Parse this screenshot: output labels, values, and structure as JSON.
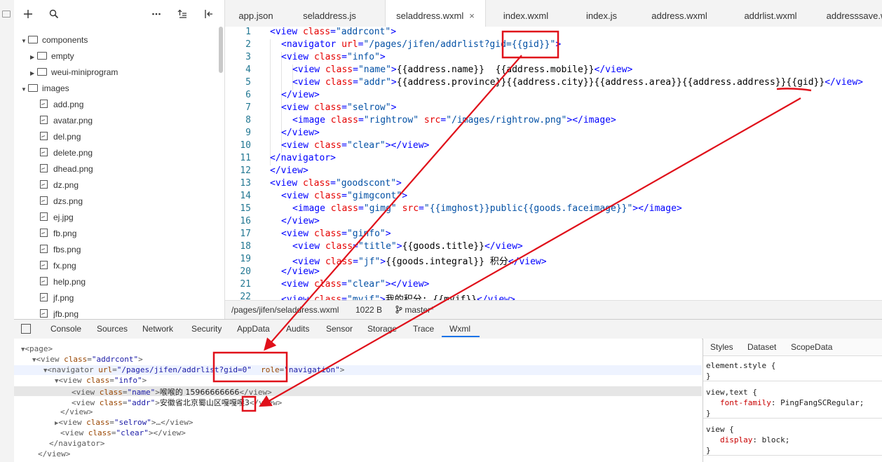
{
  "toolbar": {
    "icons": [
      "plus-icon",
      "search-icon",
      "more-icon",
      "sort-icon",
      "split-icon"
    ]
  },
  "tree": {
    "items": [
      {
        "label": "components",
        "kind": "folder",
        "open": true,
        "depth": 0
      },
      {
        "label": "empty",
        "kind": "folder",
        "open": false,
        "depth": 1
      },
      {
        "label": "weui-miniprogram",
        "kind": "folder",
        "open": false,
        "depth": 1
      },
      {
        "label": "images",
        "kind": "folder",
        "open": true,
        "depth": 0
      },
      {
        "label": "add.png",
        "kind": "image",
        "depth": 1
      },
      {
        "label": "avatar.png",
        "kind": "image",
        "depth": 1
      },
      {
        "label": "del.png",
        "kind": "image",
        "depth": 1
      },
      {
        "label": "delete.png",
        "kind": "image",
        "depth": 1
      },
      {
        "label": "dhead.png",
        "kind": "image",
        "depth": 1
      },
      {
        "label": "dz.png",
        "kind": "image",
        "depth": 1
      },
      {
        "label": "dzs.png",
        "kind": "image",
        "depth": 1
      },
      {
        "label": "ej.jpg",
        "kind": "image",
        "depth": 1
      },
      {
        "label": "fb.png",
        "kind": "image",
        "depth": 1
      },
      {
        "label": "fbs.png",
        "kind": "image",
        "depth": 1
      },
      {
        "label": "fx.png",
        "kind": "image",
        "depth": 1
      },
      {
        "label": "help.png",
        "kind": "image",
        "depth": 1
      },
      {
        "label": "jf.png",
        "kind": "image",
        "depth": 1
      },
      {
        "label": "jfb.png",
        "kind": "image",
        "depth": 1
      }
    ]
  },
  "editor": {
    "tabs": [
      {
        "label": "app.json"
      },
      {
        "label": "seladdress.js"
      },
      {
        "label": "seladdress.wxml",
        "active": true,
        "close": "×"
      },
      {
        "label": "index.wxml"
      },
      {
        "label": "index.js"
      },
      {
        "label": "address.wxml"
      },
      {
        "label": "addrlist.wxml"
      },
      {
        "label": "addresssave.w"
      }
    ],
    "lines": [
      {
        "n": "1",
        "indent": 0,
        "segs": [
          [
            "t",
            "<view "
          ],
          [
            "a",
            "class"
          ],
          [
            "t",
            "="
          ],
          [
            "s",
            "\"addrcont\""
          ],
          [
            "t",
            ">"
          ]
        ]
      },
      {
        "n": "2",
        "indent": 1,
        "segs": [
          [
            "t",
            "<navigator "
          ],
          [
            "a",
            "url"
          ],
          [
            "t",
            "="
          ],
          [
            "s",
            "\"/pages/jifen/addrlist?gid={{gid}}\""
          ],
          [
            "t",
            ">"
          ]
        ]
      },
      {
        "n": "3",
        "indent": 1,
        "segs": [
          [
            "t",
            "<view "
          ],
          [
            "a",
            "class"
          ],
          [
            "t",
            "="
          ],
          [
            "s",
            "\"info\""
          ],
          [
            "t",
            ">"
          ]
        ]
      },
      {
        "n": "4",
        "indent": 2,
        "segs": [
          [
            "t",
            "<view "
          ],
          [
            "a",
            "class"
          ],
          [
            "t",
            "="
          ],
          [
            "s",
            "\"name\""
          ],
          [
            "t",
            ">"
          ],
          [
            "x",
            "{{address.name}}  {{address.mobile}}"
          ],
          [
            "t",
            "</view>"
          ]
        ]
      },
      {
        "n": "5",
        "indent": 2,
        "segs": [
          [
            "t",
            "<view "
          ],
          [
            "a",
            "class"
          ],
          [
            "t",
            "="
          ],
          [
            "s",
            "\"addr\""
          ],
          [
            "t",
            ">"
          ],
          [
            "x",
            "{{address.province}}{{address.city}}{{address.area}}{{address.address}}{{gid}}"
          ],
          [
            "t",
            "</view>"
          ]
        ]
      },
      {
        "n": "6",
        "indent": 1,
        "segs": [
          [
            "t",
            "</view>"
          ]
        ]
      },
      {
        "n": "7",
        "indent": 1,
        "segs": [
          [
            "t",
            "<view "
          ],
          [
            "a",
            "class"
          ],
          [
            "t",
            "="
          ],
          [
            "s",
            "\"selrow\""
          ],
          [
            "t",
            ">"
          ]
        ]
      },
      {
        "n": "8",
        "indent": 2,
        "segs": [
          [
            "t",
            "<image "
          ],
          [
            "a",
            "class"
          ],
          [
            "t",
            "="
          ],
          [
            "s",
            "\"rightrow\""
          ],
          [
            "t",
            " "
          ],
          [
            "a",
            "src"
          ],
          [
            "t",
            "="
          ],
          [
            "s",
            "\"/images/rightrow.png\""
          ],
          [
            "t",
            "></image>"
          ]
        ]
      },
      {
        "n": "9",
        "indent": 1,
        "segs": [
          [
            "t",
            "</view>"
          ]
        ]
      },
      {
        "n": "10",
        "indent": 1,
        "segs": [
          [
            "t",
            "<view "
          ],
          [
            "a",
            "class"
          ],
          [
            "t",
            "="
          ],
          [
            "s",
            "\"clear\""
          ],
          [
            "t",
            "></view>"
          ]
        ]
      },
      {
        "n": "11",
        "indent": 0,
        "segs": [
          [
            "t",
            "</navigator>"
          ]
        ]
      },
      {
        "n": "12",
        "indent": 0,
        "segs": [
          [
            "t",
            "</view>"
          ]
        ]
      },
      {
        "n": "13",
        "indent": 0,
        "segs": [
          [
            "t",
            "<view "
          ],
          [
            "a",
            "class"
          ],
          [
            "t",
            "="
          ],
          [
            "s",
            "\"goodscont\""
          ],
          [
            "t",
            ">"
          ]
        ]
      },
      {
        "n": "14",
        "indent": 1,
        "segs": [
          [
            "t",
            "<view "
          ],
          [
            "a",
            "class"
          ],
          [
            "t",
            "="
          ],
          [
            "s",
            "\"gimgcont\""
          ],
          [
            "t",
            ">"
          ]
        ]
      },
      {
        "n": "15",
        "indent": 2,
        "segs": [
          [
            "t",
            "<image "
          ],
          [
            "a",
            "class"
          ],
          [
            "t",
            "="
          ],
          [
            "s",
            "\"gimg\""
          ],
          [
            "t",
            " "
          ],
          [
            "a",
            "src"
          ],
          [
            "t",
            "="
          ],
          [
            "s",
            "\"{{imghost}}public{{goods.faceimage}}\""
          ],
          [
            "t",
            "></image>"
          ]
        ]
      },
      {
        "n": "16",
        "indent": 1,
        "segs": [
          [
            "t",
            "</view>"
          ]
        ]
      },
      {
        "n": "17",
        "indent": 1,
        "segs": [
          [
            "t",
            "<view "
          ],
          [
            "a",
            "class"
          ],
          [
            "t",
            "="
          ],
          [
            "s",
            "\"ginfo\""
          ],
          [
            "t",
            ">"
          ]
        ]
      },
      {
        "n": "18",
        "indent": 2,
        "segs": [
          [
            "t",
            "<view "
          ],
          [
            "a",
            "class"
          ],
          [
            "t",
            "="
          ],
          [
            "s",
            "\"title\""
          ],
          [
            "t",
            ">"
          ],
          [
            "x",
            "{{goods.title}}"
          ],
          [
            "t",
            "</view>"
          ]
        ]
      },
      {
        "n": "19",
        "indent": 2,
        "segs": [
          [
            "t",
            "<view "
          ],
          [
            "a",
            "class"
          ],
          [
            "t",
            "="
          ],
          [
            "s",
            "\"jf\""
          ],
          [
            "t",
            ">"
          ],
          [
            "x",
            "{{goods.integral}} 积分"
          ],
          [
            "t",
            "</view>"
          ]
        ]
      },
      {
        "n": "20",
        "indent": 1,
        "segs": [
          [
            "t",
            "</view>"
          ]
        ]
      },
      {
        "n": "21",
        "indent": 1,
        "segs": [
          [
            "t",
            "<view "
          ],
          [
            "a",
            "class"
          ],
          [
            "t",
            "="
          ],
          [
            "s",
            "\"clear\""
          ],
          [
            "t",
            "></view>"
          ]
        ]
      },
      {
        "n": "22",
        "indent": 1,
        "segs": [
          [
            "t",
            "<view "
          ],
          [
            "a",
            "class"
          ],
          [
            "t",
            "="
          ],
          [
            "s",
            "\"myjf\""
          ],
          [
            "t",
            ">"
          ],
          [
            "x",
            "我的积分: {{myjf}}"
          ],
          [
            "t",
            "</view>"
          ]
        ]
      }
    ]
  },
  "status": {
    "path": "/pages/jifen/seladdress.wxml",
    "size": "1022 B",
    "branch": "master*"
  },
  "devtools": {
    "tabs": [
      "Console",
      "Sources",
      "Network",
      "Security",
      "AppData",
      "Audits",
      "Sensor",
      "Storage",
      "Trace",
      "Wxml"
    ],
    "active": "Wxml"
  },
  "dom": {
    "lines": [
      {
        "ind": 0,
        "tog": "▼",
        "segs": [
          [
            "tg",
            "<page>"
          ]
        ]
      },
      {
        "ind": 1,
        "tog": "▼",
        "segs": [
          [
            "tg",
            "<view "
          ],
          [
            "an",
            "class"
          ],
          [
            "tg",
            "="
          ],
          [
            "av",
            "\"addrcont\""
          ],
          [
            "tg",
            ">"
          ]
        ]
      },
      {
        "ind": 2,
        "tog": "▼",
        "segs": [
          [
            "tg",
            "<navigator "
          ],
          [
            "an",
            "url"
          ],
          [
            "tg",
            "="
          ],
          [
            "av",
            "\"/pages/jifen/addrlist?gid=0\""
          ],
          [
            "tg",
            "  "
          ],
          [
            "an",
            "role"
          ],
          [
            "tg",
            "="
          ],
          [
            "av",
            "\"navigation\""
          ],
          [
            "tg",
            ">"
          ]
        ]
      },
      {
        "ind": 3,
        "tog": "▼",
        "segs": [
          [
            "tg",
            "<view "
          ],
          [
            "an",
            "class"
          ],
          [
            "tg",
            "="
          ],
          [
            "av",
            "\"info\""
          ],
          [
            "tg",
            ">"
          ]
        ]
      },
      {
        "ind": 4,
        "tog": "",
        "segs": [
          [
            "tg",
            "<view "
          ],
          [
            "an",
            "class"
          ],
          [
            "tg",
            "="
          ],
          [
            "av",
            "\"name\""
          ],
          [
            "tg",
            ">"
          ],
          [
            "tx",
            "喉喉的 15966666666"
          ],
          [
            "tg",
            "</view>"
          ]
        ]
      },
      {
        "ind": 4,
        "tog": "",
        "segs": [
          [
            "tg",
            "<view "
          ],
          [
            "an",
            "class"
          ],
          [
            "tg",
            "="
          ],
          [
            "av",
            "\"addr\""
          ],
          [
            "tg",
            ">"
          ],
          [
            "tx",
            "安徽省北京蜀山区嘎嘎嘎3"
          ],
          [
            "tg",
            "</view>"
          ]
        ]
      },
      {
        "ind": 3,
        "tog": "",
        "segs": [
          [
            "tg",
            "</view>"
          ]
        ]
      },
      {
        "ind": 3,
        "tog": "▶",
        "segs": [
          [
            "tg",
            "<view "
          ],
          [
            "an",
            "class"
          ],
          [
            "tg",
            "="
          ],
          [
            "av",
            "\"selrow\""
          ],
          [
            "tg",
            ">…</view>"
          ]
        ]
      },
      {
        "ind": 3,
        "tog": "",
        "segs": [
          [
            "tg",
            "<view "
          ],
          [
            "an",
            "class"
          ],
          [
            "tg",
            "="
          ],
          [
            "av",
            "\"clear\""
          ],
          [
            "tg",
            "></view>"
          ]
        ]
      },
      {
        "ind": 2,
        "tog": "",
        "segs": [
          [
            "tg",
            "</navigator>"
          ]
        ]
      },
      {
        "ind": 1,
        "tog": "",
        "segs": [
          [
            "tg",
            "</view>"
          ]
        ]
      }
    ]
  },
  "styles": {
    "tabs": [
      "Styles",
      "Dataset",
      "ScopeData"
    ],
    "rules": [
      {
        "selector": "element.style {",
        "props": [],
        "close": "}"
      },
      {
        "selector": "view,text {",
        "props": [
          {
            "name": "font-family",
            "value": "PingFangSCRegular;"
          }
        ],
        "close": "}"
      },
      {
        "selector": "view {",
        "props": [
          {
            "name": "display",
            "value": "block;"
          }
        ],
        "close": "}"
      }
    ]
  },
  "colors": {
    "annotation": "#e0101a",
    "tag": "#0000ff",
    "attr": "#e50000",
    "string": "#0451a5"
  }
}
